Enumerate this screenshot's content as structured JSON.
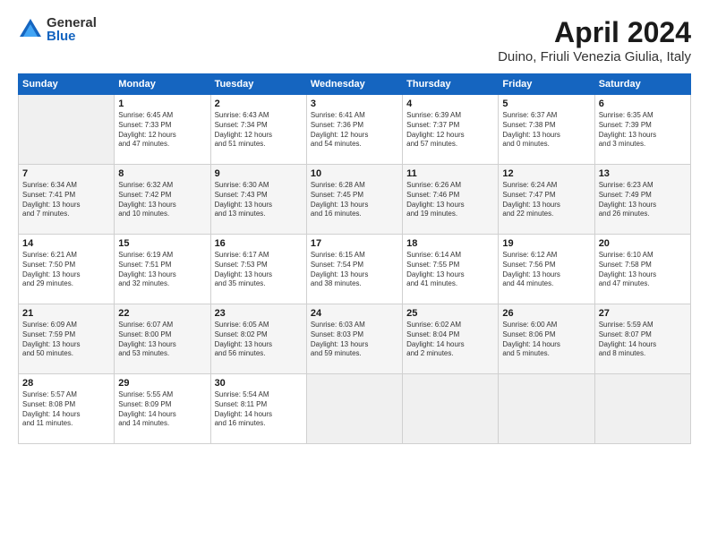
{
  "header": {
    "logo_general": "General",
    "logo_blue": "Blue",
    "title": "April 2024",
    "subtitle": "Duino, Friuli Venezia Giulia, Italy"
  },
  "columns": [
    "Sunday",
    "Monday",
    "Tuesday",
    "Wednesday",
    "Thursday",
    "Friday",
    "Saturday"
  ],
  "rows": [
    [
      {
        "num": "",
        "info": ""
      },
      {
        "num": "1",
        "info": "Sunrise: 6:45 AM\nSunset: 7:33 PM\nDaylight: 12 hours\nand 47 minutes."
      },
      {
        "num": "2",
        "info": "Sunrise: 6:43 AM\nSunset: 7:34 PM\nDaylight: 12 hours\nand 51 minutes."
      },
      {
        "num": "3",
        "info": "Sunrise: 6:41 AM\nSunset: 7:36 PM\nDaylight: 12 hours\nand 54 minutes."
      },
      {
        "num": "4",
        "info": "Sunrise: 6:39 AM\nSunset: 7:37 PM\nDaylight: 12 hours\nand 57 minutes."
      },
      {
        "num": "5",
        "info": "Sunrise: 6:37 AM\nSunset: 7:38 PM\nDaylight: 13 hours\nand 0 minutes."
      },
      {
        "num": "6",
        "info": "Sunrise: 6:35 AM\nSunset: 7:39 PM\nDaylight: 13 hours\nand 3 minutes."
      }
    ],
    [
      {
        "num": "7",
        "info": "Sunrise: 6:34 AM\nSunset: 7:41 PM\nDaylight: 13 hours\nand 7 minutes."
      },
      {
        "num": "8",
        "info": "Sunrise: 6:32 AM\nSunset: 7:42 PM\nDaylight: 13 hours\nand 10 minutes."
      },
      {
        "num": "9",
        "info": "Sunrise: 6:30 AM\nSunset: 7:43 PM\nDaylight: 13 hours\nand 13 minutes."
      },
      {
        "num": "10",
        "info": "Sunrise: 6:28 AM\nSunset: 7:45 PM\nDaylight: 13 hours\nand 16 minutes."
      },
      {
        "num": "11",
        "info": "Sunrise: 6:26 AM\nSunset: 7:46 PM\nDaylight: 13 hours\nand 19 minutes."
      },
      {
        "num": "12",
        "info": "Sunrise: 6:24 AM\nSunset: 7:47 PM\nDaylight: 13 hours\nand 22 minutes."
      },
      {
        "num": "13",
        "info": "Sunrise: 6:23 AM\nSunset: 7:49 PM\nDaylight: 13 hours\nand 26 minutes."
      }
    ],
    [
      {
        "num": "14",
        "info": "Sunrise: 6:21 AM\nSunset: 7:50 PM\nDaylight: 13 hours\nand 29 minutes."
      },
      {
        "num": "15",
        "info": "Sunrise: 6:19 AM\nSunset: 7:51 PM\nDaylight: 13 hours\nand 32 minutes."
      },
      {
        "num": "16",
        "info": "Sunrise: 6:17 AM\nSunset: 7:53 PM\nDaylight: 13 hours\nand 35 minutes."
      },
      {
        "num": "17",
        "info": "Sunrise: 6:15 AM\nSunset: 7:54 PM\nDaylight: 13 hours\nand 38 minutes."
      },
      {
        "num": "18",
        "info": "Sunrise: 6:14 AM\nSunset: 7:55 PM\nDaylight: 13 hours\nand 41 minutes."
      },
      {
        "num": "19",
        "info": "Sunrise: 6:12 AM\nSunset: 7:56 PM\nDaylight: 13 hours\nand 44 minutes."
      },
      {
        "num": "20",
        "info": "Sunrise: 6:10 AM\nSunset: 7:58 PM\nDaylight: 13 hours\nand 47 minutes."
      }
    ],
    [
      {
        "num": "21",
        "info": "Sunrise: 6:09 AM\nSunset: 7:59 PM\nDaylight: 13 hours\nand 50 minutes."
      },
      {
        "num": "22",
        "info": "Sunrise: 6:07 AM\nSunset: 8:00 PM\nDaylight: 13 hours\nand 53 minutes."
      },
      {
        "num": "23",
        "info": "Sunrise: 6:05 AM\nSunset: 8:02 PM\nDaylight: 13 hours\nand 56 minutes."
      },
      {
        "num": "24",
        "info": "Sunrise: 6:03 AM\nSunset: 8:03 PM\nDaylight: 13 hours\nand 59 minutes."
      },
      {
        "num": "25",
        "info": "Sunrise: 6:02 AM\nSunset: 8:04 PM\nDaylight: 14 hours\nand 2 minutes."
      },
      {
        "num": "26",
        "info": "Sunrise: 6:00 AM\nSunset: 8:06 PM\nDaylight: 14 hours\nand 5 minutes."
      },
      {
        "num": "27",
        "info": "Sunrise: 5:59 AM\nSunset: 8:07 PM\nDaylight: 14 hours\nand 8 minutes."
      }
    ],
    [
      {
        "num": "28",
        "info": "Sunrise: 5:57 AM\nSunset: 8:08 PM\nDaylight: 14 hours\nand 11 minutes."
      },
      {
        "num": "29",
        "info": "Sunrise: 5:55 AM\nSunset: 8:09 PM\nDaylight: 14 hours\nand 14 minutes."
      },
      {
        "num": "30",
        "info": "Sunrise: 5:54 AM\nSunset: 8:11 PM\nDaylight: 14 hours\nand 16 minutes."
      },
      {
        "num": "",
        "info": ""
      },
      {
        "num": "",
        "info": ""
      },
      {
        "num": "",
        "info": ""
      },
      {
        "num": "",
        "info": ""
      }
    ]
  ]
}
